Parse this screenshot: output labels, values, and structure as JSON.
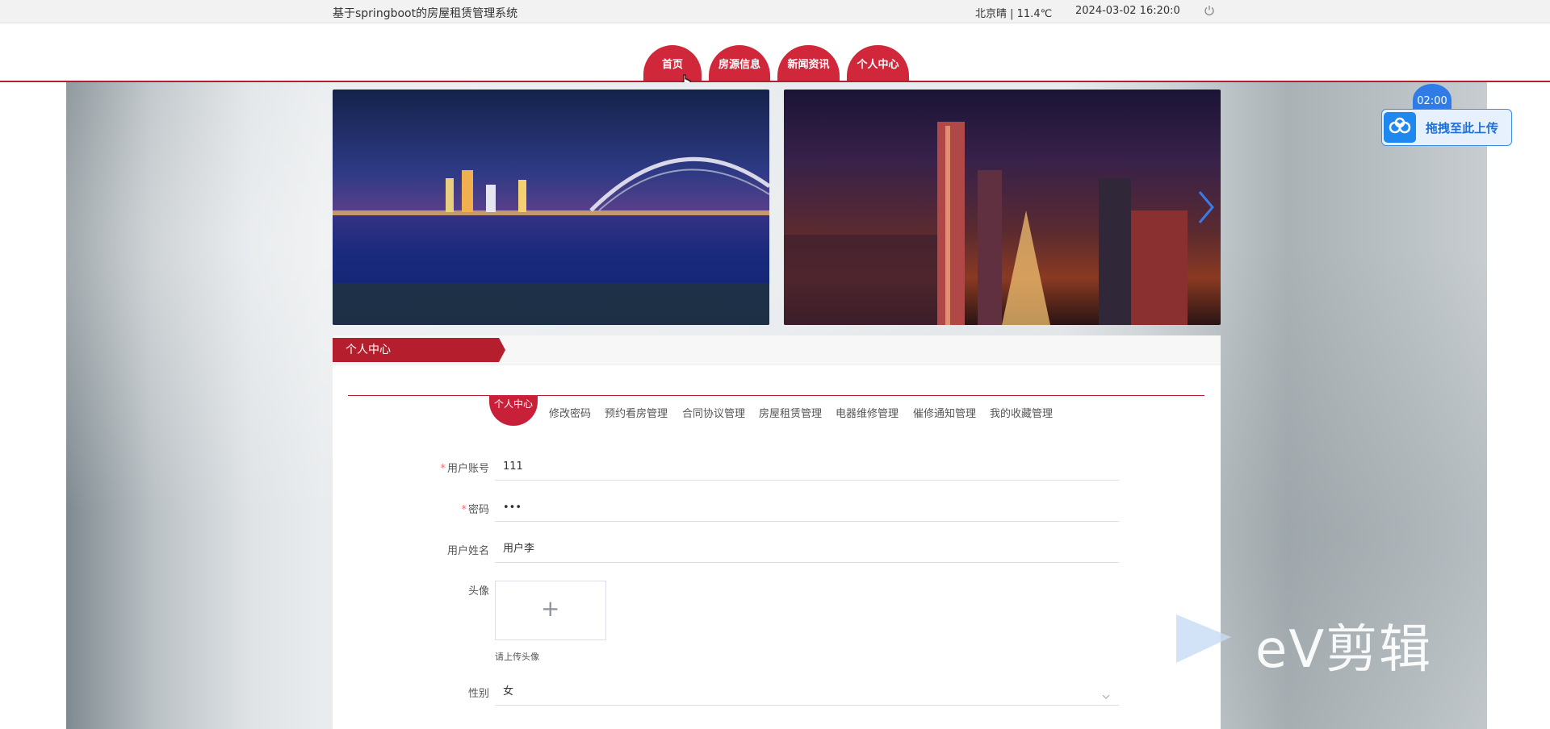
{
  "header": {
    "site_title": "基于springboot的房屋租赁管理系统",
    "weather": "北京晴 | 11.4℃",
    "datetime": "2024-03-02   16:20:0",
    "power_icon": "power-icon"
  },
  "nav": {
    "items": [
      {
        "label": "首页"
      },
      {
        "label": "房源信息"
      },
      {
        "label": "新闻资讯"
      },
      {
        "label": "个人中心"
      }
    ],
    "active_index": 0,
    "accent_color": "#d0283a"
  },
  "carousel": {
    "next_icon": "chevron-right-icon",
    "slides": [
      {
        "description_icon": "city-bridge-night-image"
      },
      {
        "description_icon": "city-skyline-night-image"
      }
    ]
  },
  "panel": {
    "title": "个人中心",
    "tabs": [
      {
        "label": "个人中心"
      },
      {
        "label": "修改密码"
      },
      {
        "label": "预约看房管理"
      },
      {
        "label": "合同协议管理"
      },
      {
        "label": "房屋租赁管理"
      },
      {
        "label": "电器维修管理"
      },
      {
        "label": "催修通知管理"
      },
      {
        "label": "我的收藏管理"
      }
    ],
    "active_tab_index": 0
  },
  "form": {
    "account": {
      "label": "用户账号",
      "required": "*",
      "value": "111"
    },
    "password": {
      "label": "密码",
      "required": "*",
      "value": "•••"
    },
    "name": {
      "label": "用户姓名",
      "value": "用户李"
    },
    "avatar": {
      "label": "头像",
      "plus": "+",
      "tip": "请上传头像"
    },
    "gender": {
      "label": "性别",
      "value": "女"
    }
  },
  "floating": {
    "timer": "02:00",
    "upload_label": "拖拽至此上传",
    "upload_icon": "baidu-cloud-icon"
  },
  "watermark": {
    "text": "eV剪辑"
  }
}
